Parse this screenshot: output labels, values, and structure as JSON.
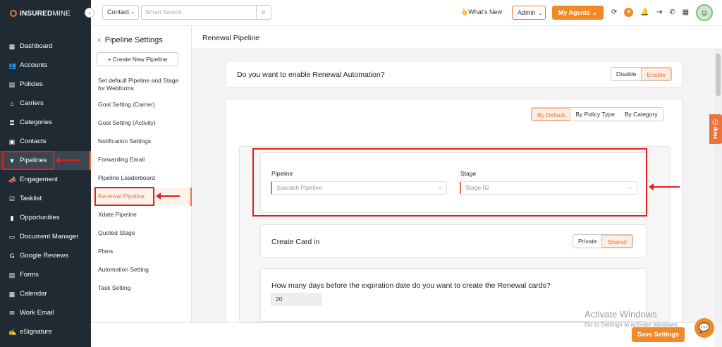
{
  "brand": {
    "logo_bold": "INSURED",
    "logo_thin": "MINE"
  },
  "sidebar": {
    "items": [
      {
        "label": "Dashboard",
        "icon": "dashboard-icon"
      },
      {
        "label": "Accounts",
        "icon": "accounts-icon"
      },
      {
        "label": "Policies",
        "icon": "policies-icon"
      },
      {
        "label": "Carriers",
        "icon": "carriers-icon"
      },
      {
        "label": "Categories",
        "icon": "categories-icon"
      },
      {
        "label": "Contacts",
        "icon": "contacts-icon"
      },
      {
        "label": "Pipelines",
        "icon": "pipelines-icon",
        "active": true
      },
      {
        "label": "Engagement",
        "icon": "engagement-icon"
      },
      {
        "label": "Tasklist",
        "icon": "tasklist-icon"
      },
      {
        "label": "Opportunities",
        "icon": "opportunities-icon"
      },
      {
        "label": "Document Manager",
        "icon": "folder-icon"
      },
      {
        "label": "Google Reviews",
        "icon": "google-icon"
      },
      {
        "label": "Forms",
        "icon": "forms-icon"
      },
      {
        "label": "Calendar",
        "icon": "calendar-icon"
      },
      {
        "label": "Work Email",
        "icon": "email-icon"
      },
      {
        "label": "eSignature",
        "icon": "signature-icon"
      }
    ]
  },
  "topbar": {
    "contact_select": "Contact",
    "search_placeholder": "Smart Search",
    "whats_new": "What's New",
    "admin": "Admin",
    "my_agents": "My Agents"
  },
  "settings_nav": {
    "title": "Pipeline Settings",
    "create_button": "+ Create New Pipeline",
    "items": [
      "Set default Pipeline and Stage for Webforms",
      "Goal Setting (Carrier)",
      "Goal Setting (Activity)",
      "Notification Settings",
      "Forwarding Email",
      "Pipeline Leaderboard",
      "Renewal Pipeline",
      "Xdate Pipeline",
      "Quoted Stage",
      "Plans",
      "Automation Setting",
      "Task Setting"
    ],
    "active_index": 6
  },
  "main": {
    "header": "Renewal Pipeline",
    "automation_question": "Do you want to enable Renewal Automation?",
    "automation_toggle": {
      "disable": "Disable",
      "enable": "Enable",
      "selected": "Enable"
    },
    "mode_tabs": {
      "by_default": "By Default",
      "by_policy_type": "By Policy Type",
      "by_category": "By Category",
      "selected": "By Default"
    },
    "pipeline_label": "Pipeline",
    "pipeline_value": "Saurabh Pipeline",
    "stage_label": "Stage",
    "stage_value": "Stage 02",
    "create_card_label": "Create Card in",
    "card_toggle": {
      "private": "Private",
      "shared": "Shared",
      "selected": "Shared"
    },
    "days_question": "How many days before the expiration date do you want to create the Renewal cards?",
    "days_value": "20",
    "save_button": "Save Settings"
  },
  "help_tab": "Help",
  "watermark": {
    "line1": "Activate Windows",
    "line2": "Go to Settings to activate Windows."
  },
  "colors": {
    "accent": "#f08a28",
    "sidebar_bg": "#1f2a33",
    "annotation_red": "#e01f1f"
  }
}
